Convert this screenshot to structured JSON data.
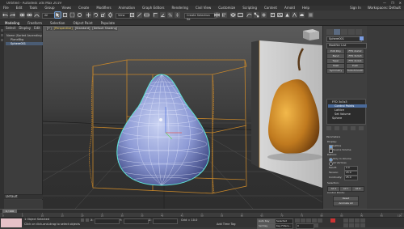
{
  "window": {
    "title": "Untitled - Autodesk 3ds Max 2019",
    "controls": [
      "—",
      "❐",
      "✕"
    ]
  },
  "menu": {
    "items": [
      "File",
      "Edit",
      "Tools",
      "Group",
      "Views",
      "Create",
      "Modifiers",
      "Animation",
      "Graph Editors",
      "Rendering",
      "Civil View",
      "Customize",
      "Scripting",
      "Content",
      "Arnold",
      "Help"
    ],
    "signin": "Sign In",
    "workspaces": "Workspaces: Default"
  },
  "toolbar": {
    "filter_value": "All",
    "viewcs_value": "View",
    "selection_set_value": "Create Selection Se"
  },
  "ribbon": {
    "tabs": [
      "Modeling",
      "Freeform",
      "Selection",
      "Object Paint",
      "Populate"
    ],
    "active": "Modeling"
  },
  "explorer": {
    "tabs": [
      "Select",
      "Display",
      "Edit"
    ],
    "rows": [
      {
        "label": "Name (Sorted Ascending)",
        "selected": false
      },
      {
        "label": "PlaneBkg",
        "selected": false
      },
      {
        "label": "Sphere001",
        "selected": true
      }
    ],
    "workspace": "Default"
  },
  "viewport": {
    "labels": [
      "[+]",
      "[Perspective]",
      "[Standard]",
      "[Default Shading]"
    ],
    "highlight_index": 1
  },
  "command_panel": {
    "object_name": "Sphere001",
    "modifier_list": "Modifier List",
    "modifier_buttons": [
      "Edit Poly",
      "FFD 2x2x2",
      "Bend",
      "FFD 3x3x3",
      "Taper",
      "FFD 4x4x4",
      "Shell",
      "Push",
      "Symmetry",
      "TurboSmooth"
    ],
    "stack_items": [
      {
        "label": "FFD 3x3x3",
        "selected": false
      },
      {
        "label": "Control Points",
        "selected": true
      },
      {
        "label": "Lattice",
        "selected": false
      },
      {
        "label": "Set Volume",
        "selected": false
      },
      {
        "label": "Sphere",
        "selected": false
      }
    ],
    "parameters": {
      "heading": "Parameters",
      "display_label": "Display:",
      "lattice_label": "Lattice",
      "source_volume_label": "Source Volume",
      "deform_label": "Deform:",
      "only_in_volume": "Only In Volume",
      "all_vertices": "All Vertices",
      "falloff_label": "Falloff:",
      "falloff_value": "0.0",
      "tension_label": "Tension:",
      "tension_value": "25.0",
      "continuity_label": "Continuity:",
      "continuity_value": "25.0",
      "selection_label": "Selection:",
      "all_x": "All X",
      "all_y": "All Y",
      "all_z": "All Z",
      "control_points_label": "Control Points:",
      "reset_btn": "Reset",
      "animate_all_btn": "Animate All",
      "conform_btn": "Conform to Shape"
    }
  },
  "timeline": {
    "frame": "0 / 100",
    "ticks": [
      "0",
      "5",
      "10",
      "15",
      "20",
      "25",
      "30",
      "35",
      "40",
      "45",
      "50",
      "55",
      "60",
      "65",
      "70",
      "75",
      "80",
      "85",
      "90",
      "95",
      "100"
    ]
  },
  "status": {
    "selected": "1 Object Selected",
    "prompt": "Click or click-and-drag to select objects",
    "x_label": "X:",
    "y_label": "Y:",
    "z_label": "Z:",
    "grid": "Grid = 10.0",
    "add_time_tag": "Add Time Tag",
    "auto_key": "Auto Key",
    "selected_filter": "Selected",
    "set_key": "Set Key",
    "key_filters": "Key Filters...",
    "frame_field": "0"
  },
  "colors": {
    "cage": "#c8872a",
    "mesh": "#8d9ad6",
    "selection": "#5fe6d6"
  }
}
